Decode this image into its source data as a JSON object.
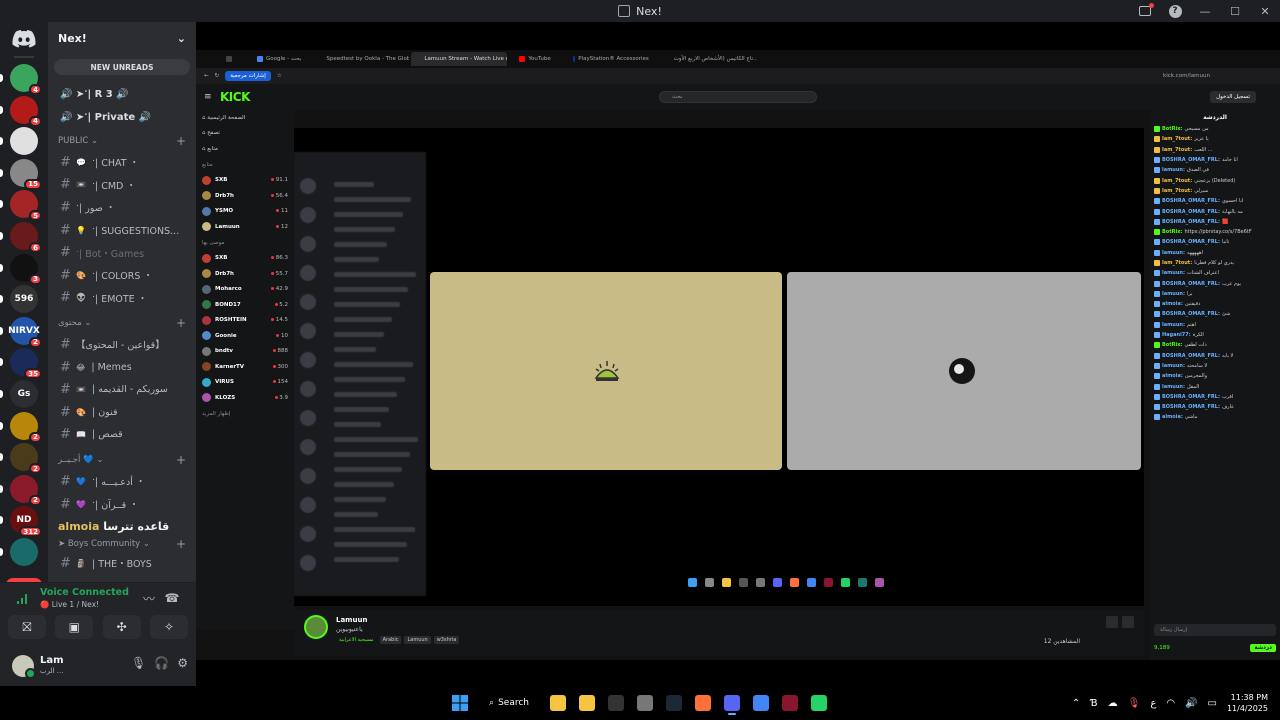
{
  "window": {
    "title": "Nex!",
    "controls": {
      "minimize": "—",
      "maximize": "☐",
      "close": "✕"
    },
    "help": "?"
  },
  "rail": {
    "servers": [
      {
        "color": "#3ba55d",
        "badge": "4"
      },
      {
        "color": "#b31b1b",
        "badge": "4"
      },
      {
        "color": "#e0e0e0",
        "badge": ""
      },
      {
        "color": "#888888",
        "badge": "15"
      },
      {
        "color": "#a32525",
        "badge": "5"
      },
      {
        "color": "#6b1a1a",
        "badge": "6"
      },
      {
        "color": "#111111",
        "badge": "3"
      },
      {
        "color": "#333333",
        "badge": "",
        "text": "596"
      },
      {
        "color": "#2255aa",
        "badge": "2",
        "text": "NIRVX"
      },
      {
        "color": "#1a2b5a",
        "badge": "35"
      },
      {
        "color": "#2b2d31",
        "badge": "",
        "text": "Gs"
      },
      {
        "color": "#b8860b",
        "badge": "2"
      },
      {
        "color": "#4a3b1a",
        "badge": "2"
      },
      {
        "color": "#8b1a2b",
        "badge": "2"
      },
      {
        "color": "#6a0f0f",
        "badge": "312",
        "text": "ND"
      },
      {
        "color": "#1a6a6a",
        "badge": ""
      }
    ],
    "new_label": "NEW"
  },
  "sidebar": {
    "guild_name": "Nex!",
    "new_unreads": "NEW UNREADS",
    "voice_channels": [
      {
        "label": "🔊 ➤ॱ| R 3 🔊"
      },
      {
        "label": "🔊 ➤ॱ| Private 🔊"
      }
    ],
    "categories": [
      {
        "name": "PUBLIC",
        "channels": [
          {
            "emoji": "💬",
            "label": "ॱ| CHAT ・",
            "dim": false
          },
          {
            "emoji": "📼",
            "label": "ॱ| CMD ・",
            "dim": false
          },
          {
            "emoji": "",
            "label": "ॱ| صور ・",
            "dim": false
          },
          {
            "emoji": "💡",
            "label": "ॱ| SUGGESTIONS...",
            "dim": false
          },
          {
            "emoji": "",
            "label": "ॱ| Bot・Games",
            "dim": true
          },
          {
            "emoji": "🎨",
            "label": "ॱ| COLORS ・",
            "dim": false
          },
          {
            "emoji": "👽",
            "label": "ॱ| EMOTE ・",
            "dim": false
          }
        ]
      },
      {
        "name": "محتوى",
        "channels": [
          {
            "emoji": "",
            "label": "【قواعين - المحتوى】",
            "dim": false
          },
          {
            "emoji": "😂",
            "label": "| Memes",
            "dim": false
          },
          {
            "emoji": "📼",
            "label": "| سوريكم - القديمه",
            "dim": false
          },
          {
            "emoji": "🎨",
            "label": "| فنون",
            "dim": false
          },
          {
            "emoji": "📖",
            "label": "| قصص",
            "dim": false
          }
        ]
      },
      {
        "name": "أجـيــر 💙",
        "channels": [
          {
            "emoji": "💙",
            "label": "ॱ| أدعـيـــه ・",
            "dim": false
          },
          {
            "emoji": "💜",
            "label": "ॱ| قــرآن ・",
            "dim": false
          }
        ]
      }
    ],
    "overlay_text": {
      "left": "almoia",
      "right": "قاعده تترسا"
    },
    "boys_category": "Boys Community",
    "boys_channel": {
      "emoji": "🗿",
      "label": "| THE・BOYS"
    }
  },
  "voice_panel": {
    "status": "Voice Connected",
    "subtitle": "🔴 Live 1 / Nex!"
  },
  "user": {
    "name": "Lam",
    "status": "الرب ..."
  },
  "browser": {
    "tabs": [
      {
        "label": "",
        "color": "#444",
        "active": false
      },
      {
        "label": "Google - بحث",
        "color": "#4285f4",
        "active": false
      },
      {
        "label": "Speedtest by Ookla - The Glob...",
        "color": "#888",
        "active": false
      },
      {
        "label": "Lamuun Stream - Watch Live on...",
        "color": "#53fc18",
        "active": true
      },
      {
        "label": "YouTube",
        "color": "#ff0000",
        "active": false
      },
      {
        "label": "PlayStation® Accessories",
        "color": "#003791",
        "active": false
      },
      {
        "label": "تاج الكاتيس (الأشخاص الاربع الأوت...",
        "color": "#2266dd",
        "active": false
      }
    ],
    "bookmark": "إشارات مرجعية",
    "url": "kick.com/lamuun"
  },
  "kick": {
    "logo": "KICK",
    "search_placeholder": "بحث",
    "login": "تسجيل الدخول",
    "side_nav": [
      "الصفحة الرئيسية",
      "تصفح",
      "متابع"
    ],
    "section_following": "متابع",
    "following": [
      {
        "name": "SXB",
        "viewers": "91.1",
        "color": "#c04030"
      },
      {
        "name": "Drb7h",
        "viewers": "56.4",
        "color": "#aa8844"
      },
      {
        "name": "YSMO",
        "viewers": "11",
        "color": "#5577aa"
      },
      {
        "name": "Lamuun",
        "viewers": "12",
        "color": "#c8bb86"
      }
    ],
    "section_recommended": "موصى بها",
    "recommended": [
      {
        "name": "SXB",
        "viewers": "86.3",
        "color": "#c04030"
      },
      {
        "name": "Drb7h",
        "viewers": "55.7",
        "color": "#aa8844"
      },
      {
        "name": "Moharco",
        "viewers": "42.9",
        "color": "#556677"
      },
      {
        "name": "BOND17",
        "viewers": "5.2",
        "color": "#337744"
      },
      {
        "name": "ROSHTEIN",
        "viewers": "14.5",
        "color": "#aa3344"
      },
      {
        "name": "Goonie",
        "viewers": "10",
        "color": "#5588cc"
      },
      {
        "name": "bndtv",
        "viewers": "888",
        "color": "#777777"
      },
      {
        "name": "KarnerTV",
        "viewers": "300",
        "color": "#884422"
      },
      {
        "name": "VIRUS",
        "viewers": "154",
        "color": "#33aacc"
      },
      {
        "name": "KLOZS",
        "viewers": "3.9",
        "color": "#aa55aa"
      }
    ],
    "show_more": "إظهار المزيد",
    "streamer": "Lamuun",
    "stream_title": "ياعتيوبيوين",
    "category": "مسيحية الاعرابية",
    "tags": [
      "Arabic",
      "Lamuun",
      "w3shria"
    ],
    "viewers": "12 المشاهدين",
    "chat_title": "الدردشة",
    "chat_messages": [
      {
        "user": "BotRix:",
        "text": "من مسيحي",
        "color": "#53fc18"
      },
      {
        "user": "Iam_7tout:",
        "text": "يا عزيز",
        "color": "#f0c040"
      },
      {
        "user": "Iam_7tout:",
        "text": "اللعب ...",
        "color": "#f0c040"
      },
      {
        "user": "BOSHRA_OMAR_FRL:",
        "text": "انا جامد",
        "color": "#6ab0ff"
      },
      {
        "user": "lamuun:",
        "text": "في الصدق",
        "color": "#6ab0ff"
      },
      {
        "user": "Iam_7tout:",
        "text": "يزعجني (Deleted)",
        "color": "#f0c040"
      },
      {
        "user": "Iam_7tout:",
        "text": "سيرلي",
        "color": "#f0c040"
      },
      {
        "user": "BOSHRA_OMAR_FRL:",
        "text": "انا احسوي",
        "color": "#6ab0ff"
      },
      {
        "user": "BOSHRA_OMAR_FRL:",
        "text": "مه بالنهاية",
        "color": "#6ab0ff"
      },
      {
        "user": "BOSHRA_OMAR_FRL:",
        "text": "🟥",
        "color": "#6ab0ff"
      },
      {
        "user": "BotRix:",
        "text": "https://pbrstay.co/s/7Be6tF",
        "color": "#53fc18"
      },
      {
        "user": "BOSHRA_OMAR_FRL:",
        "text": "ثانيا",
        "color": "#6ab0ff"
      },
      {
        "user": "lamuun:",
        "text": "اهههههه",
        "color": "#6ab0ff"
      },
      {
        "user": "Iam_7tout:",
        "text": "يدري لو كلام فطرنا",
        "color": "#f0c040"
      },
      {
        "user": "lamuun:",
        "text": "اعتراف الشتات",
        "color": "#6ab0ff"
      },
      {
        "user": "BOSHRA_OMAR_FRL:",
        "text": "يوم عرب",
        "color": "#6ab0ff"
      },
      {
        "user": "lamuun:",
        "text": "برا",
        "color": "#6ab0ff"
      },
      {
        "user": "almoia:",
        "text": "دقيقتين",
        "color": "#6ab0ff"
      },
      {
        "user": "BOSHRA_OMAR_FRL:",
        "text": "شئ",
        "color": "#6ab0ff"
      },
      {
        "user": "lamuun:",
        "text": "اهتم",
        "color": "#6ab0ff"
      },
      {
        "user": "Hagani77:",
        "text": "الكرة",
        "color": "#6ab0ff"
      },
      {
        "user": "BotRix:",
        "text": "ذات لطفي",
        "color": "#53fc18"
      },
      {
        "user": "BOSHRA_OMAR_FRL:",
        "text": "لا يابه",
        "color": "#6ab0ff"
      },
      {
        "user": "lamuun:",
        "text": "لا سامحته",
        "color": "#6ab0ff"
      },
      {
        "user": "almoia:",
        "text": "والمجرمين",
        "color": "#6ab0ff"
      },
      {
        "user": "lamuun:",
        "text": "المقل",
        "color": "#6ab0ff"
      },
      {
        "user": "BOSHRA_OMAR_FRL:",
        "text": "اقرب",
        "color": "#6ab0ff"
      },
      {
        "user": "BOSHRA_OMAR_FRL:",
        "text": "عارف",
        "color": "#6ab0ff"
      },
      {
        "user": "almoia:",
        "text": "ماشي",
        "color": "#6ab0ff"
      }
    ],
    "chat_placeholder": "إرسال رسالة",
    "chat_points": "9,189",
    "chat_send": "دردشة"
  },
  "taskbar": {
    "search": "Search",
    "apps": [
      {
        "name": "file-explorer",
        "color": "#f5c542"
      },
      {
        "name": "folder",
        "color": "#f5c542"
      },
      {
        "name": "epic-games",
        "color": "#333333"
      },
      {
        "name": "unity",
        "color": "#777777"
      },
      {
        "name": "steam",
        "color": "#1b2838"
      },
      {
        "name": "firefox",
        "color": "#ff7139"
      },
      {
        "name": "discord",
        "color": "#5865f2"
      },
      {
        "name": "chrome",
        "color": "#4285f4"
      },
      {
        "name": "next",
        "color": "#8a1530"
      },
      {
        "name": "whatsapp",
        "color": "#25d366"
      }
    ],
    "tray_lang": "ع",
    "time": "11:38 PM",
    "date": "11/4/2025"
  }
}
